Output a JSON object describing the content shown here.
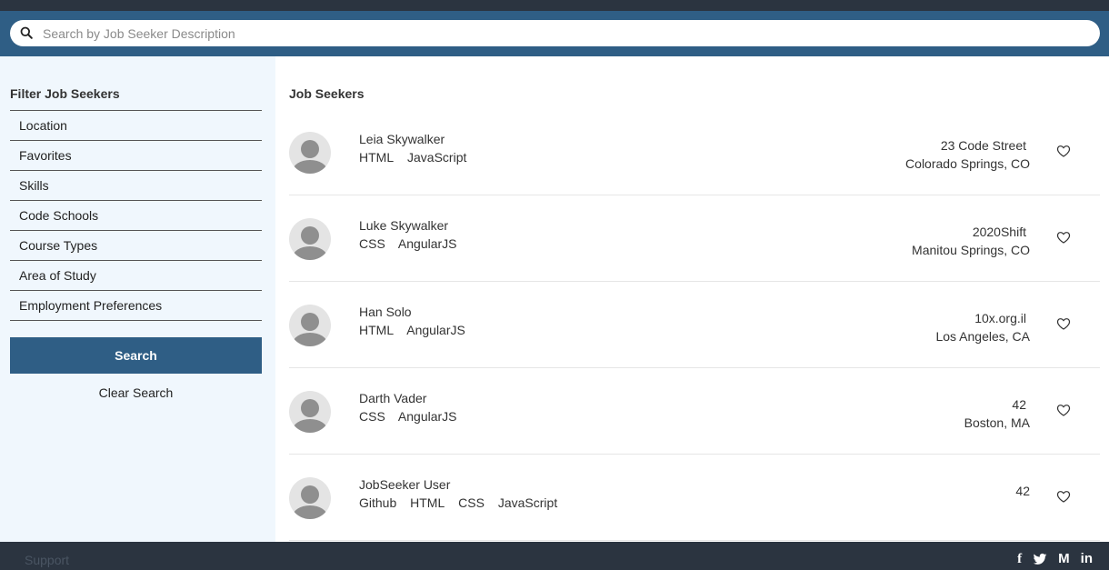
{
  "search": {
    "placeholder": "Search by Job Seeker Description"
  },
  "sidebar": {
    "title": "Filter Job Seekers",
    "filters": [
      "Location",
      "Favorites",
      "Skills",
      "Code Schools",
      "Course Types",
      "Area of Study",
      "Employment Preferences"
    ],
    "search_label": "Search",
    "clear_label": "Clear Search"
  },
  "main": {
    "title": "Job Seekers",
    "seekers": [
      {
        "name": "Leia Skywalker",
        "skills": [
          "HTML",
          "JavaScript"
        ],
        "address_line1": "23 Code Street",
        "address_line2": "Colorado Springs, CO"
      },
      {
        "name": "Luke Skywalker",
        "skills": [
          "CSS",
          "AngularJS"
        ],
        "address_line1": "2020Shift",
        "address_line2": "Manitou Springs, CO"
      },
      {
        "name": "Han Solo",
        "skills": [
          "HTML",
          "AngularJS"
        ],
        "address_line1": "10x.org.il",
        "address_line2": "Los Angeles, CA"
      },
      {
        "name": "Darth Vader",
        "skills": [
          "CSS",
          "AngularJS"
        ],
        "address_line1": "42",
        "address_line2": "Boston, MA"
      },
      {
        "name": "JobSeeker User",
        "skills": [
          "Github",
          "HTML",
          "CSS",
          "JavaScript"
        ],
        "address_line1": "",
        "address_line2": "42"
      }
    ]
  },
  "footer": {
    "support_label": "Support",
    "social": [
      {
        "icon": "facebook-icon",
        "glyph": "f"
      },
      {
        "icon": "twitter-icon",
        "glyph": "t"
      },
      {
        "icon": "medium-icon",
        "glyph": "M"
      },
      {
        "icon": "linkedin-icon",
        "glyph": "in"
      }
    ]
  },
  "colors": {
    "accent": "#2f5e85",
    "topbar": "#2b3440",
    "sidebar_bg": "#f0f7fd"
  }
}
